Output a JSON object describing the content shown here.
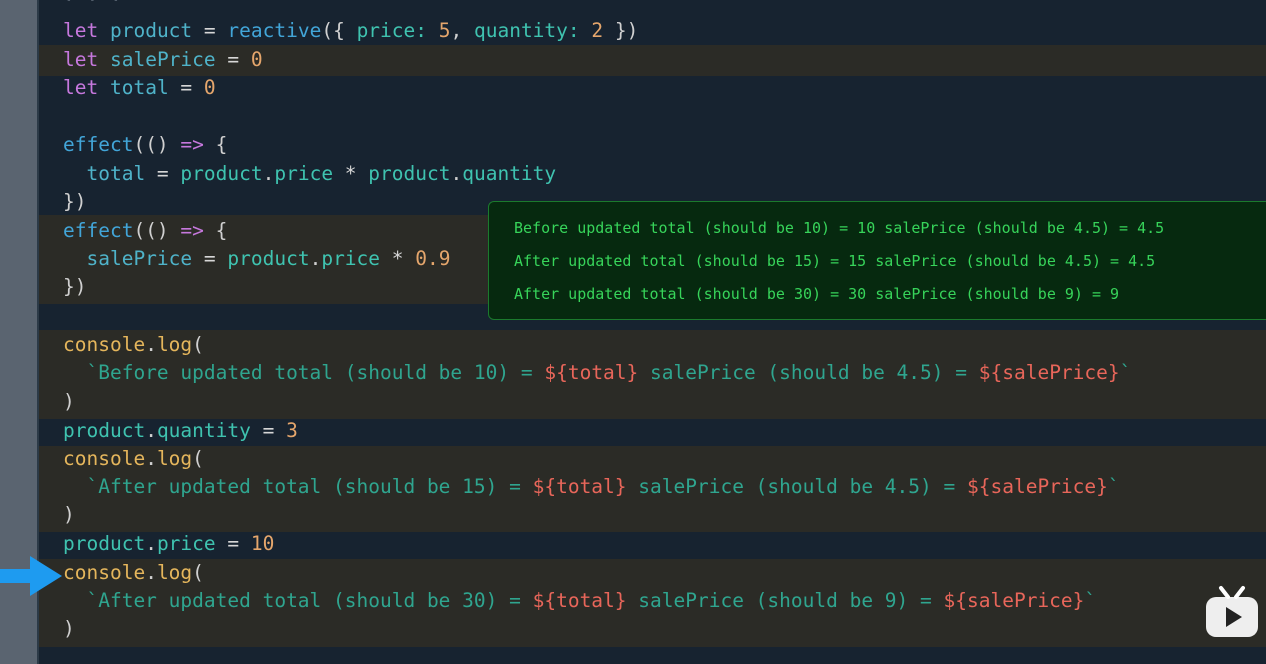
{
  "top_fragment": "· · ·",
  "code": {
    "l1": {
      "kw": "let",
      "name": "product",
      "eq": " = ",
      "call": "reactive",
      "open": "({ ",
      "k1": "price",
      "c1": ": ",
      "v1": "5",
      "sep": ", ",
      "k2": "quantity",
      "c2": ": ",
      "v2": "2",
      "close": " })"
    },
    "l2": {
      "kw": "let",
      "name": "salePrice",
      "eq": " = ",
      "val": "0"
    },
    "l3": {
      "kw": "let",
      "name": "total",
      "eq": " = ",
      "val": "0"
    },
    "l4": {
      "fn": "effect",
      "open": "(() ",
      "arrow": "=>",
      "brace": " {"
    },
    "l5": {
      "lhs": "total",
      "eq": " = ",
      "o1": "product",
      "dot1": ".",
      "p1": "price",
      "mul": " * ",
      "o2": "product",
      "dot2": ".",
      "p2": "quantity"
    },
    "l6": {
      "close": "})"
    },
    "l7": {
      "fn": "effect",
      "open": "(() ",
      "arrow": "=>",
      "brace": " {"
    },
    "l8": {
      "lhs": "salePrice",
      "eq": " = ",
      "o1": "product",
      "dot1": ".",
      "p1": "price",
      "mul": " * ",
      "num": "0.9"
    },
    "l9": {
      "close": "})"
    },
    "l10": {
      "obj": "console",
      "dot": ".",
      "m": "log",
      "open": "("
    },
    "l11": {
      "s1": "`Before updated total (should be 10) = ",
      "i1": "${total}",
      "s2": " salePrice (should be 4.5) = ",
      "i2": "${salePrice}",
      "s3": "`"
    },
    "l12": {
      "close": ")"
    },
    "l13": {
      "obj": "product",
      "dot": ".",
      "p": "quantity",
      "eq": " = ",
      "val": "3"
    },
    "l14": {
      "obj": "console",
      "dot": ".",
      "m": "log",
      "open": "("
    },
    "l15": {
      "s1": "`After updated total (should be 15) = ",
      "i1": "${total}",
      "s2": " salePrice (should be 4.5) = ",
      "i2": "${salePrice}",
      "s3": "`"
    },
    "l16": {
      "close": ")"
    },
    "l17": {
      "obj": "product",
      "dot": ".",
      "p": "price",
      "eq": " = ",
      "val": "10"
    },
    "l18": {
      "obj": "console",
      "dot": ".",
      "m": "log",
      "open": "("
    },
    "l19": {
      "s1": "`After updated total (should be 30) = ",
      "i1": "${total}",
      "s2": " salePrice (should be 9) = ",
      "i2": "${salePrice}",
      "s3": "`"
    },
    "l20": {
      "close": ")"
    }
  },
  "console_output": [
    "Before updated total (should be 10) = 10 salePrice (should be 4.5) = 4.5",
    "After updated total (should be 15) = 15 salePrice (should be 4.5) = 4.5",
    "After updated total (should be 30) = 30 salePrice (should be 9) = 9"
  ],
  "colors": {
    "editor_bg": "#172330",
    "highlight_bg": "#2b2b26",
    "console_bg": "#06290f",
    "console_text": "#37d45a",
    "pointer_arrow": "#1e9bf0"
  },
  "icons": {
    "pointer": "arrow-right-icon",
    "logo": "bilibili-tv-icon"
  }
}
